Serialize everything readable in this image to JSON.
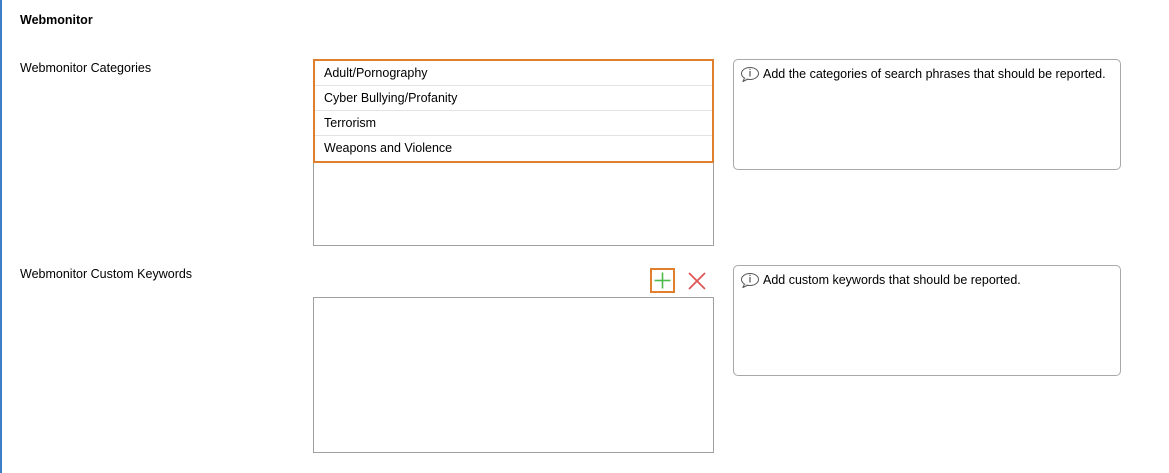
{
  "section": {
    "title": "Webmonitor"
  },
  "categories": {
    "label": "Webmonitor Categories",
    "items": [
      {
        "label": "Adult/Pornography"
      },
      {
        "label": "Cyber Bullying/Profanity"
      },
      {
        "label": "Terrorism"
      },
      {
        "label": "Weapons and Violence"
      }
    ],
    "hint": "Add the categories of search phrases that should be reported."
  },
  "keywords": {
    "label": "Webmonitor Custom Keywords",
    "hint": "Add custom keywords that should be reported.",
    "items": []
  },
  "icons": {
    "hint": "speech-bubble-info-icon",
    "add": "plus-icon",
    "delete": "x-icon"
  },
  "colors": {
    "highlight_border": "#e07f2e",
    "add_icon": "#4cbb4c",
    "delete_icon": "#e05555",
    "window_edge": "#3c7fc7"
  }
}
